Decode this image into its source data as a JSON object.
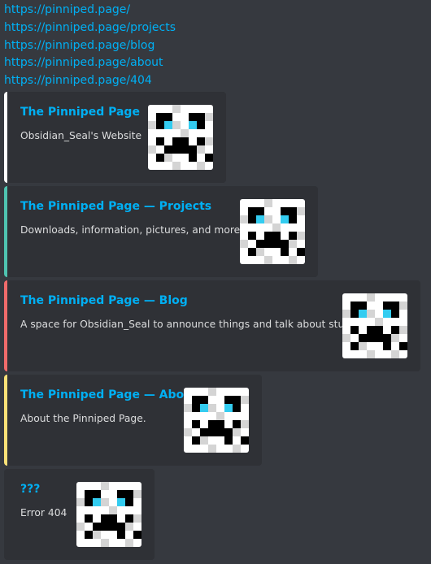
{
  "links": [
    "https://pinniped.page/",
    "https://pinniped.page/projects",
    "https://pinniped.page/blog",
    "https://pinniped.page/about",
    "https://pinniped.page/404"
  ],
  "embeds": [
    {
      "title": "The Pinniped Page",
      "description": "Obsidian_Seal's Website",
      "accent_color": "#ffffff",
      "thumbnail_icon": "pixel-seal-icon"
    },
    {
      "title": "The Pinniped Page — Projects",
      "description": "Downloads, information, pictures, and more!",
      "accent_color": "#4fc3b0",
      "thumbnail_icon": "pixel-seal-icon"
    },
    {
      "title": "The Pinniped Page — Blog",
      "description": "A space for Obsidian_Seal to announce things and talk about stuff.",
      "accent_color": "#f06b6b",
      "thumbnail_icon": "pixel-seal-icon"
    },
    {
      "title": "The Pinniped Page — About",
      "description": "About the Pinniped Page.",
      "accent_color": "#fae177",
      "thumbnail_icon": "pixel-seal-icon"
    },
    {
      "title": "???",
      "description": "Error 404",
      "accent_color": "#2f3136",
      "thumbnail_icon": "pixel-seal-icon"
    }
  ],
  "colors": {
    "background": "#36393f",
    "embed_background": "#2f3136",
    "link": "#00b0f4",
    "text": "#dcddde"
  }
}
